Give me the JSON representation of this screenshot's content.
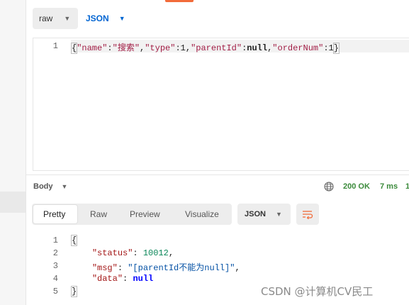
{
  "request": {
    "body_mode": "raw",
    "language": "JSON",
    "editor": {
      "line_numbers": [
        "1"
      ],
      "tokens": [
        "{",
        "\"name\"",
        ":",
        "\"搜索\"",
        ",",
        "\"type\"",
        ":",
        "1",
        ",",
        "\"parentId\"",
        ":",
        "null",
        ",",
        "\"orderNum\"",
        ":",
        "1",
        "}"
      ]
    }
  },
  "response": {
    "section_label": "Body",
    "status": "200 OK",
    "time": "7 ms",
    "size_partial": "1",
    "tabs": [
      "Pretty",
      "Raw",
      "Preview",
      "Visualize"
    ],
    "active_tab": "Pretty",
    "format": "JSON",
    "line_numbers": [
      "1",
      "2",
      "3",
      "4",
      "5"
    ],
    "lines": {
      "open": "{",
      "status_key": "\"status\"",
      "status_value": "10012",
      "msg_key": "\"msg\"",
      "msg_value": "\"[parentId不能为null]\"",
      "data_key": "\"data\"",
      "data_value": "null",
      "close": "}"
    }
  },
  "watermark": "CSDN @计算机CV民工",
  "colors": {
    "accent": "#f26b3a",
    "link_blue": "#0265d2",
    "status_green": "#3a8a3a",
    "key_red": "#a31515",
    "string_blue": "#0451a5",
    "number_green": "#098658",
    "keyword_blue": "#0000ff"
  },
  "icons": {
    "globe": "globe-icon",
    "wrap": "wrap-lines-icon",
    "dropdown": "chevron-down-icon"
  }
}
